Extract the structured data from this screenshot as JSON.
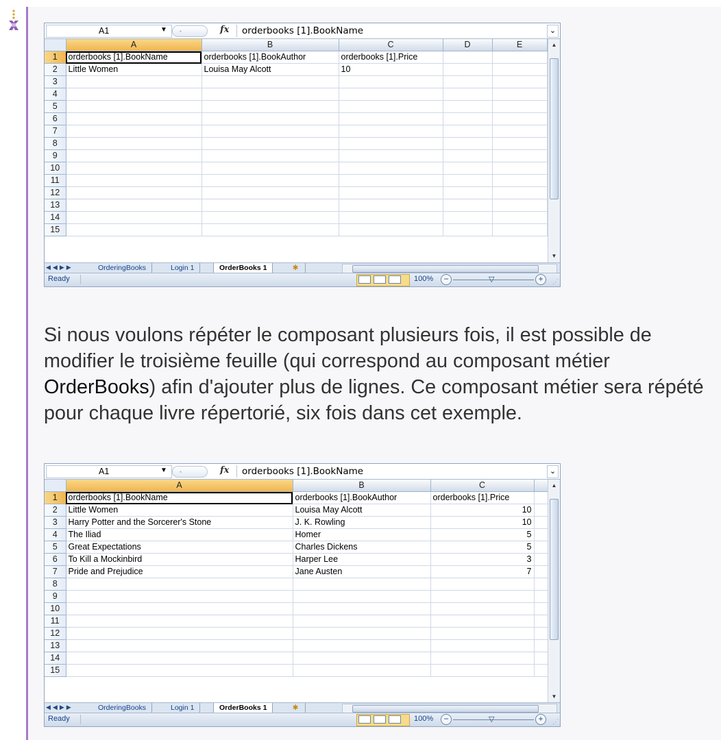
{
  "paragraph": {
    "before": "Si nous voulons répéter le composant plusieurs fois, il est possible de modifier le troisième feuille (qui correspond au composant métier ",
    "bold": "OrderBooks",
    "after": ") afin d'ajouter plus de lignes. Ce composant métier sera répété pour chaque livre répertorié, six fois dans cet exemple."
  },
  "screenshot1": {
    "namebox": "A1",
    "fx": "fx",
    "formula": "orderbooks [1].BookName",
    "columns": [
      "A",
      "B",
      "C",
      "D",
      "E"
    ],
    "rows": [
      [
        "1",
        "orderbooks [1].BookName",
        "orderbooks [1].BookAuthor",
        "orderbooks [1].Price",
        "",
        ""
      ],
      [
        "2",
        "Little Women",
        "Louisa May Alcott",
        "10",
        "",
        ""
      ],
      [
        "3",
        "",
        "",
        "",
        "",
        ""
      ],
      [
        "4",
        "",
        "",
        "",
        "",
        ""
      ],
      [
        "5",
        "",
        "",
        "",
        "",
        ""
      ],
      [
        "6",
        "",
        "",
        "",
        "",
        ""
      ],
      [
        "7",
        "",
        "",
        "",
        "",
        ""
      ],
      [
        "8",
        "",
        "",
        "",
        "",
        ""
      ],
      [
        "9",
        "",
        "",
        "",
        "",
        ""
      ],
      [
        "10",
        "",
        "",
        "",
        "",
        ""
      ],
      [
        "11",
        "",
        "",
        "",
        "",
        ""
      ],
      [
        "12",
        "",
        "",
        "",
        "",
        ""
      ],
      [
        "13",
        "",
        "",
        "",
        "",
        ""
      ],
      [
        "14",
        "",
        "",
        "",
        "",
        ""
      ],
      [
        "15",
        "",
        "",
        "",
        "",
        ""
      ]
    ],
    "tabs": [
      "OrderingBooks",
      "Login 1",
      "OrderBooks 1"
    ],
    "status": "Ready",
    "zoom": "100%"
  },
  "screenshot2": {
    "namebox": "A1",
    "fx": "fx",
    "formula": "orderbooks [1].BookName",
    "columns": [
      "A",
      "B",
      "C"
    ],
    "rows": [
      [
        "1",
        "orderbooks [1].BookName",
        "orderbooks [1].BookAuthor",
        "orderbooks [1].Price"
      ],
      [
        "2",
        "Little Women",
        "Louisa May Alcott",
        "10"
      ],
      [
        "3",
        "Harry Potter and the Sorcerer's Stone",
        "J. K. Rowling",
        "10"
      ],
      [
        "4",
        "The Iliad",
        "Homer",
        "5"
      ],
      [
        "5",
        "Great Expectations",
        "Charles Dickens",
        "5"
      ],
      [
        "6",
        "To Kill a Mockinbird",
        "Harper Lee",
        "3"
      ],
      [
        "7",
        "Pride and Prejudice",
        "Jane Austen",
        "7"
      ],
      [
        "8",
        "",
        "",
        ""
      ],
      [
        "9",
        "",
        "",
        ""
      ],
      [
        "10",
        "",
        "",
        ""
      ],
      [
        "11",
        "",
        "",
        ""
      ],
      [
        "12",
        "",
        "",
        ""
      ],
      [
        "13",
        "",
        "",
        ""
      ],
      [
        "14",
        "",
        "",
        ""
      ],
      [
        "15",
        "",
        "",
        ""
      ]
    ],
    "tabs": [
      "OrderingBooks",
      "Login 1",
      "OrderBooks 1"
    ],
    "status": "Ready",
    "zoom": "100%"
  },
  "icons": {
    "tip": "tip-icon",
    "dropdown": "chevron-down-icon",
    "expand": "expand-formula-icon",
    "insert_sheet": "insert-sheet-icon"
  },
  "colors": {
    "accent_bar": "#a57bc7",
    "selected_header": "#f2b54e",
    "excel_frame": "#8fa4c1"
  }
}
